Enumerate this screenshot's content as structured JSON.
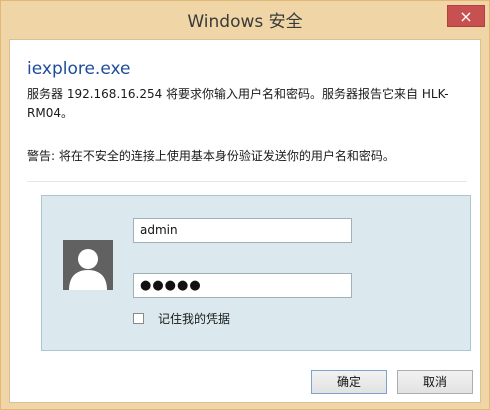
{
  "window": {
    "title": "Windows 安全",
    "close_label": "×"
  },
  "dialog": {
    "app_name": "iexplore.exe",
    "message": "服务器 192.168.16.254 将要求你输入用户名和密码。服务器报告它来自 HLK-RM04。",
    "warning": "警告: 将在不安全的连接上使用基本身份验证发送你的用户名和密码。"
  },
  "credentials": {
    "username_value": "admin",
    "password_value": "●●●●●",
    "remember_label": "记住我的凭据",
    "remember_checked": false
  },
  "buttons": {
    "ok_label": "确定",
    "cancel_label": "取消"
  },
  "icons": {
    "avatar": "user-silhouette-icon",
    "close": "close-icon"
  },
  "colors": {
    "titlebar": "#f0d6a6",
    "close_button": "#c75050",
    "app_name": "#1e4c99",
    "cred_panel": "#dbe8ee"
  }
}
